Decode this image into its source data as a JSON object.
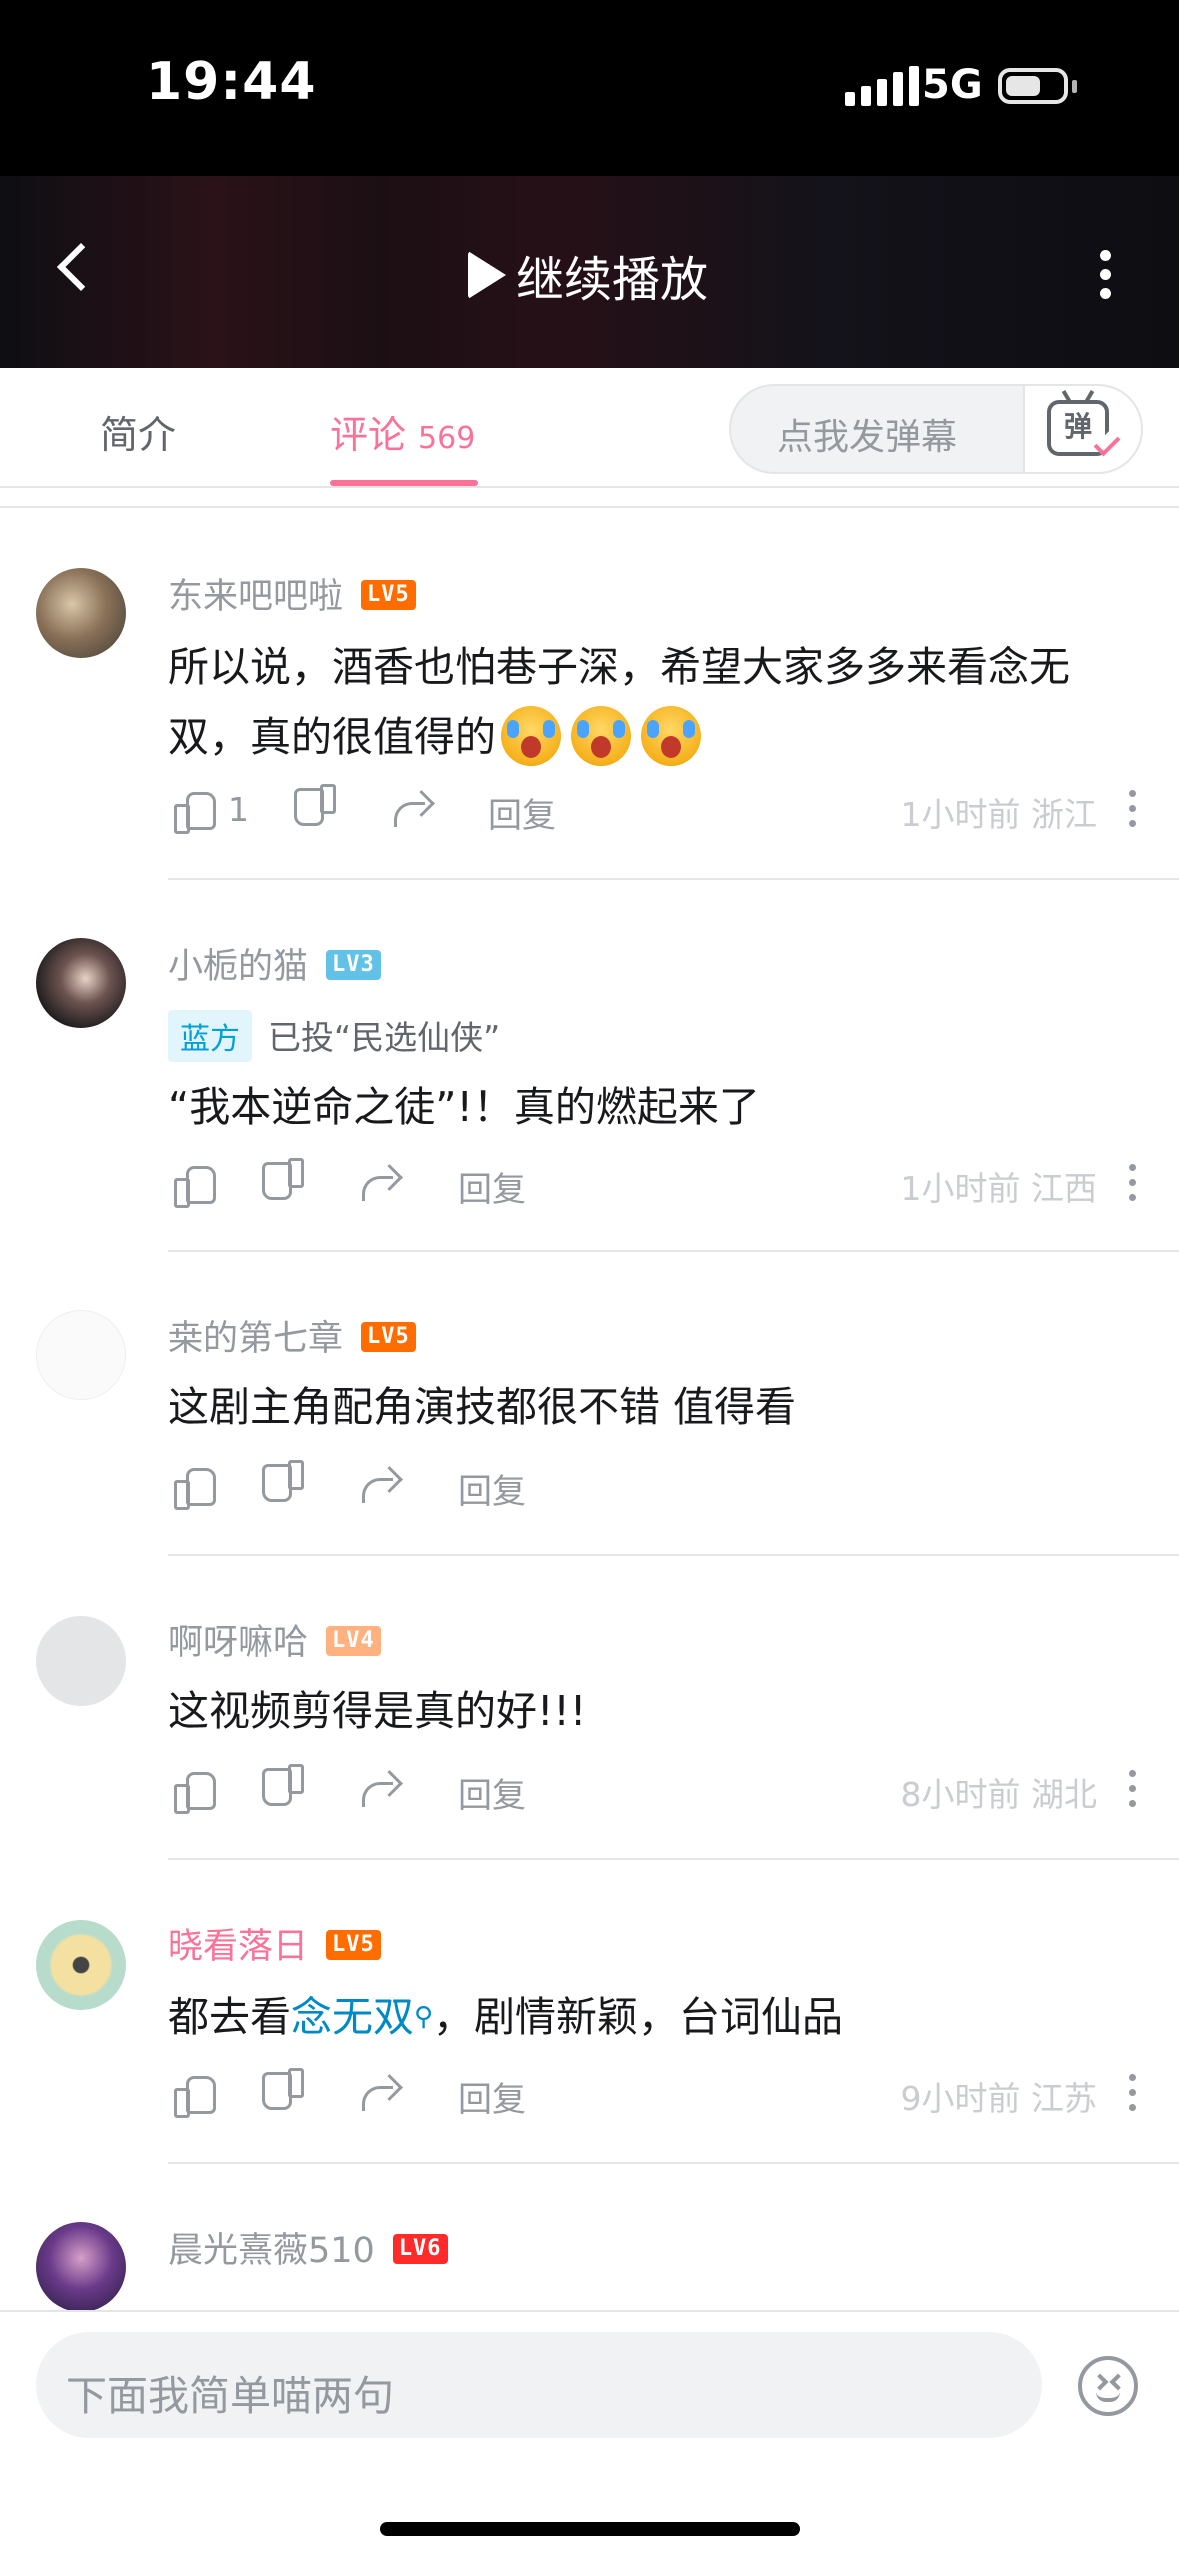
{
  "status_bar": {
    "time": "19:44",
    "network": "5G"
  },
  "video_bar": {
    "resume_label": "继续播放"
  },
  "tabs": {
    "intro_label": "简介",
    "comment_label": "评论",
    "comment_count": "569",
    "danmaku_placeholder": "点我发弹幕",
    "danmaku_icon_text": "弹"
  },
  "comments": [
    {
      "username": "东来吧吧啦",
      "level": "LV5",
      "text": "所以说，酒香也怕巷子深，希望大家多多来看念无双，真的很值得的",
      "likes": "1",
      "reply_label": "回复",
      "time": "1小时前",
      "location": "浙江"
    },
    {
      "username": "小栀的猫",
      "level": "LV3",
      "badge": "蓝方",
      "vote_text": "已投“民选仙侠”",
      "text": "“我本逆命之徒”!！真的燃起来了",
      "reply_label": "回复",
      "time": "1小时前",
      "location": "江西"
    },
    {
      "username": "桒的第七章",
      "level": "LV5",
      "text": "这剧主角配角演技都很不错 值得看",
      "reply_label": "回复"
    },
    {
      "username": "啊呀嘛哈",
      "level": "LV4",
      "text": "这视频剪得是真的好!!!",
      "reply_label": "回复",
      "time": "8小时前",
      "location": "湖北"
    },
    {
      "username": "晓看落日",
      "level": "LV5",
      "text_before": "都去看",
      "text_link": "念无双",
      "text_after": "，剧情新颖，台词仙品",
      "reply_label": "回复",
      "time": "9小时前",
      "location": "江苏"
    },
    {
      "username": "晨光熹薇510",
      "level": "LV6"
    }
  ],
  "bottom_bar": {
    "input_placeholder": "下面我简单喵两句"
  },
  "colors": {
    "accent": "#fb7299",
    "link": "#008ac5",
    "muted": "#9499a0"
  }
}
